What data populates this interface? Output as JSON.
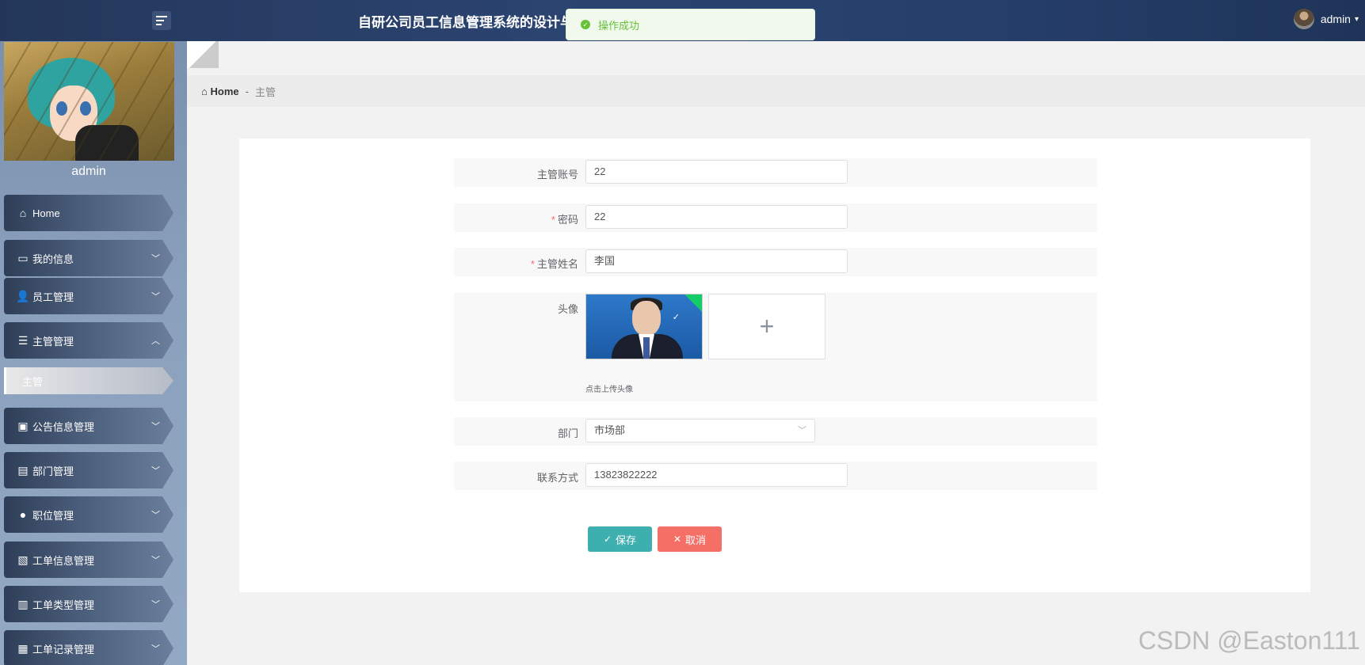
{
  "header": {
    "title": "自研公司员工信息管理系统的设计与",
    "toast": "操作成功",
    "user_name": "admin",
    "caret": "▾"
  },
  "sidebar": {
    "profile_name": "admin",
    "items": [
      {
        "label": "Home",
        "icon": "home-icon",
        "glyph": "⌂"
      },
      {
        "label": "我的信息",
        "icon": "card-icon",
        "glyph": "▭",
        "chevron": "﹀"
      },
      {
        "label": "员工管理",
        "icon": "user-icon",
        "glyph": "👤",
        "chevron": "﹀"
      },
      {
        "label": "主管管理",
        "icon": "list-icon",
        "glyph": "☰",
        "chevron": "︿"
      },
      {
        "label": "公告信息管理",
        "icon": "wallet-icon",
        "glyph": "▣",
        "chevron": "﹀"
      },
      {
        "label": "部门管理",
        "icon": "briefcase-icon",
        "glyph": "▤",
        "chevron": "﹀"
      },
      {
        "label": "职位管理",
        "icon": "bulb-icon",
        "glyph": "●",
        "chevron": "﹀"
      },
      {
        "label": "工单信息管理",
        "icon": "clipboard-x-icon",
        "glyph": "▧",
        "chevron": "﹀"
      },
      {
        "label": "工单类型管理",
        "icon": "clipboard-icon",
        "glyph": "▥",
        "chevron": "﹀"
      },
      {
        "label": "工单记录管理",
        "icon": "grid-icon",
        "glyph": "▦",
        "chevron": "﹀"
      }
    ],
    "sub_item": "主管"
  },
  "breadcrumb": {
    "home": "Home",
    "sep": "-",
    "current": "主管"
  },
  "form": {
    "account": {
      "label": "主管账号",
      "value": "22"
    },
    "password": {
      "label": "密码",
      "value": "22"
    },
    "name": {
      "label": "主管姓名",
      "value": "李国"
    },
    "avatar": {
      "label": "头像",
      "hint": "点击上传头像",
      "plus": "+",
      "check": "✓"
    },
    "department": {
      "label": "部门",
      "value": "市场部",
      "arrow": "﹀"
    },
    "contact": {
      "label": "联系方式",
      "value": "13823822222"
    },
    "required_mark": "*",
    "save_label": "保存",
    "save_glyph": "✓",
    "cancel_label": "取消",
    "cancel_glyph": "✕"
  },
  "watermark": "CSDN @Easton111",
  "colors": {
    "topbar": "#2b4470",
    "save": "#1da2a2",
    "cancel": "#f47067",
    "toast_bg": "#f0f9eb",
    "toast_text": "#67c23a"
  }
}
